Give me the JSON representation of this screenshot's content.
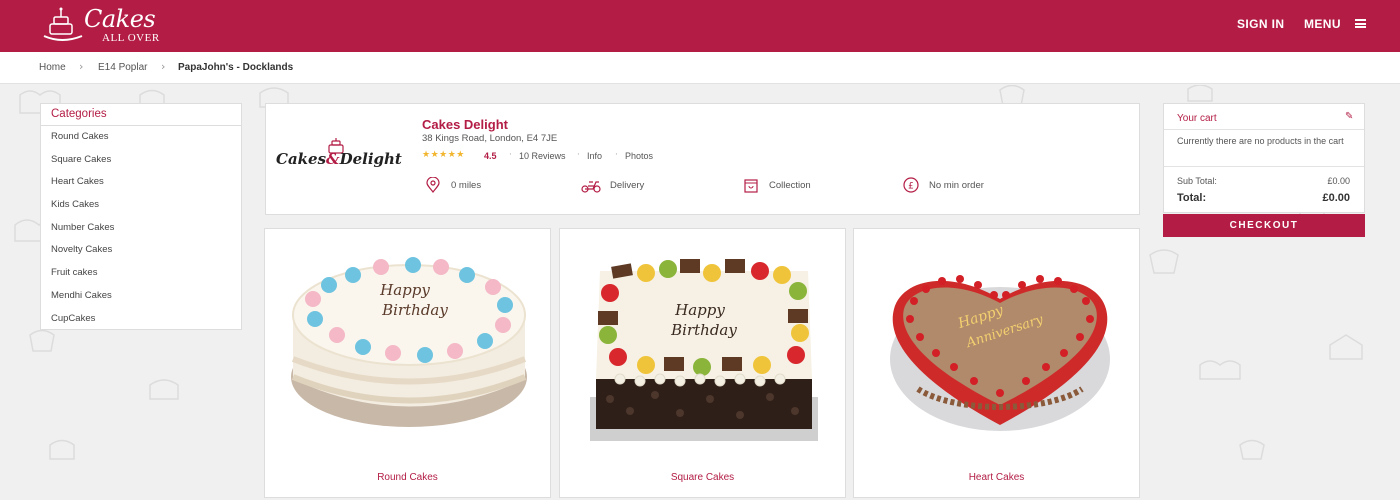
{
  "brand": {
    "logo_main": "Cakes",
    "logo_sub": "ALL OVER",
    "accent": "#b31d45"
  },
  "header": {
    "signin_label": "SIGN IN",
    "menu_label": "MENU",
    "menu_icon": "hamburger-icon"
  },
  "breadcrumb": {
    "items": [
      "Home",
      "E14 Poplar",
      "PapaJohn's - Docklands"
    ],
    "separator_icon": "chevron-right-icon"
  },
  "categories": {
    "heading": "Categories",
    "items": [
      "Round Cakes",
      "Square Cakes",
      "Heart Cakes",
      "Kids Cakes",
      "Number Cakes",
      "Novelty Cakes",
      "Fruit cakes",
      "Mendhi Cakes",
      "CupCakes"
    ]
  },
  "shop": {
    "logo_word1": "Cakes",
    "logo_amp": "&",
    "logo_word2": "Delight",
    "name": "Cakes Delight",
    "address": "38 Kings Road, London, E4 7JE",
    "stars": "★★★★★",
    "rating": "4.5",
    "reviews": "10 Reviews",
    "info_label": "Info",
    "photos_label": "Photos",
    "features": {
      "distance": "0 miles",
      "delivery": "Delivery",
      "collection": "Collection",
      "min_order": "No min order"
    }
  },
  "products": [
    {
      "label": "Round Cakes",
      "cake_text_1": "Happy",
      "cake_text_2": "Birthday"
    },
    {
      "label": "Square Cakes",
      "cake_text_1": "Happy",
      "cake_text_2": "Birthday"
    },
    {
      "label": "Heart Cakes",
      "cake_text_1": "Happy",
      "cake_text_2": "Anniversary"
    }
  ],
  "cart": {
    "title": "Your cart",
    "edit_icon": "pencil-icon",
    "empty_message": "Currently there are no products in the cart",
    "subtotal_label": "Sub Total:",
    "subtotal_value": "£0.00",
    "total_label": "Total:",
    "total_value": "£0.00",
    "checkout_label": "CHECKOUT"
  }
}
